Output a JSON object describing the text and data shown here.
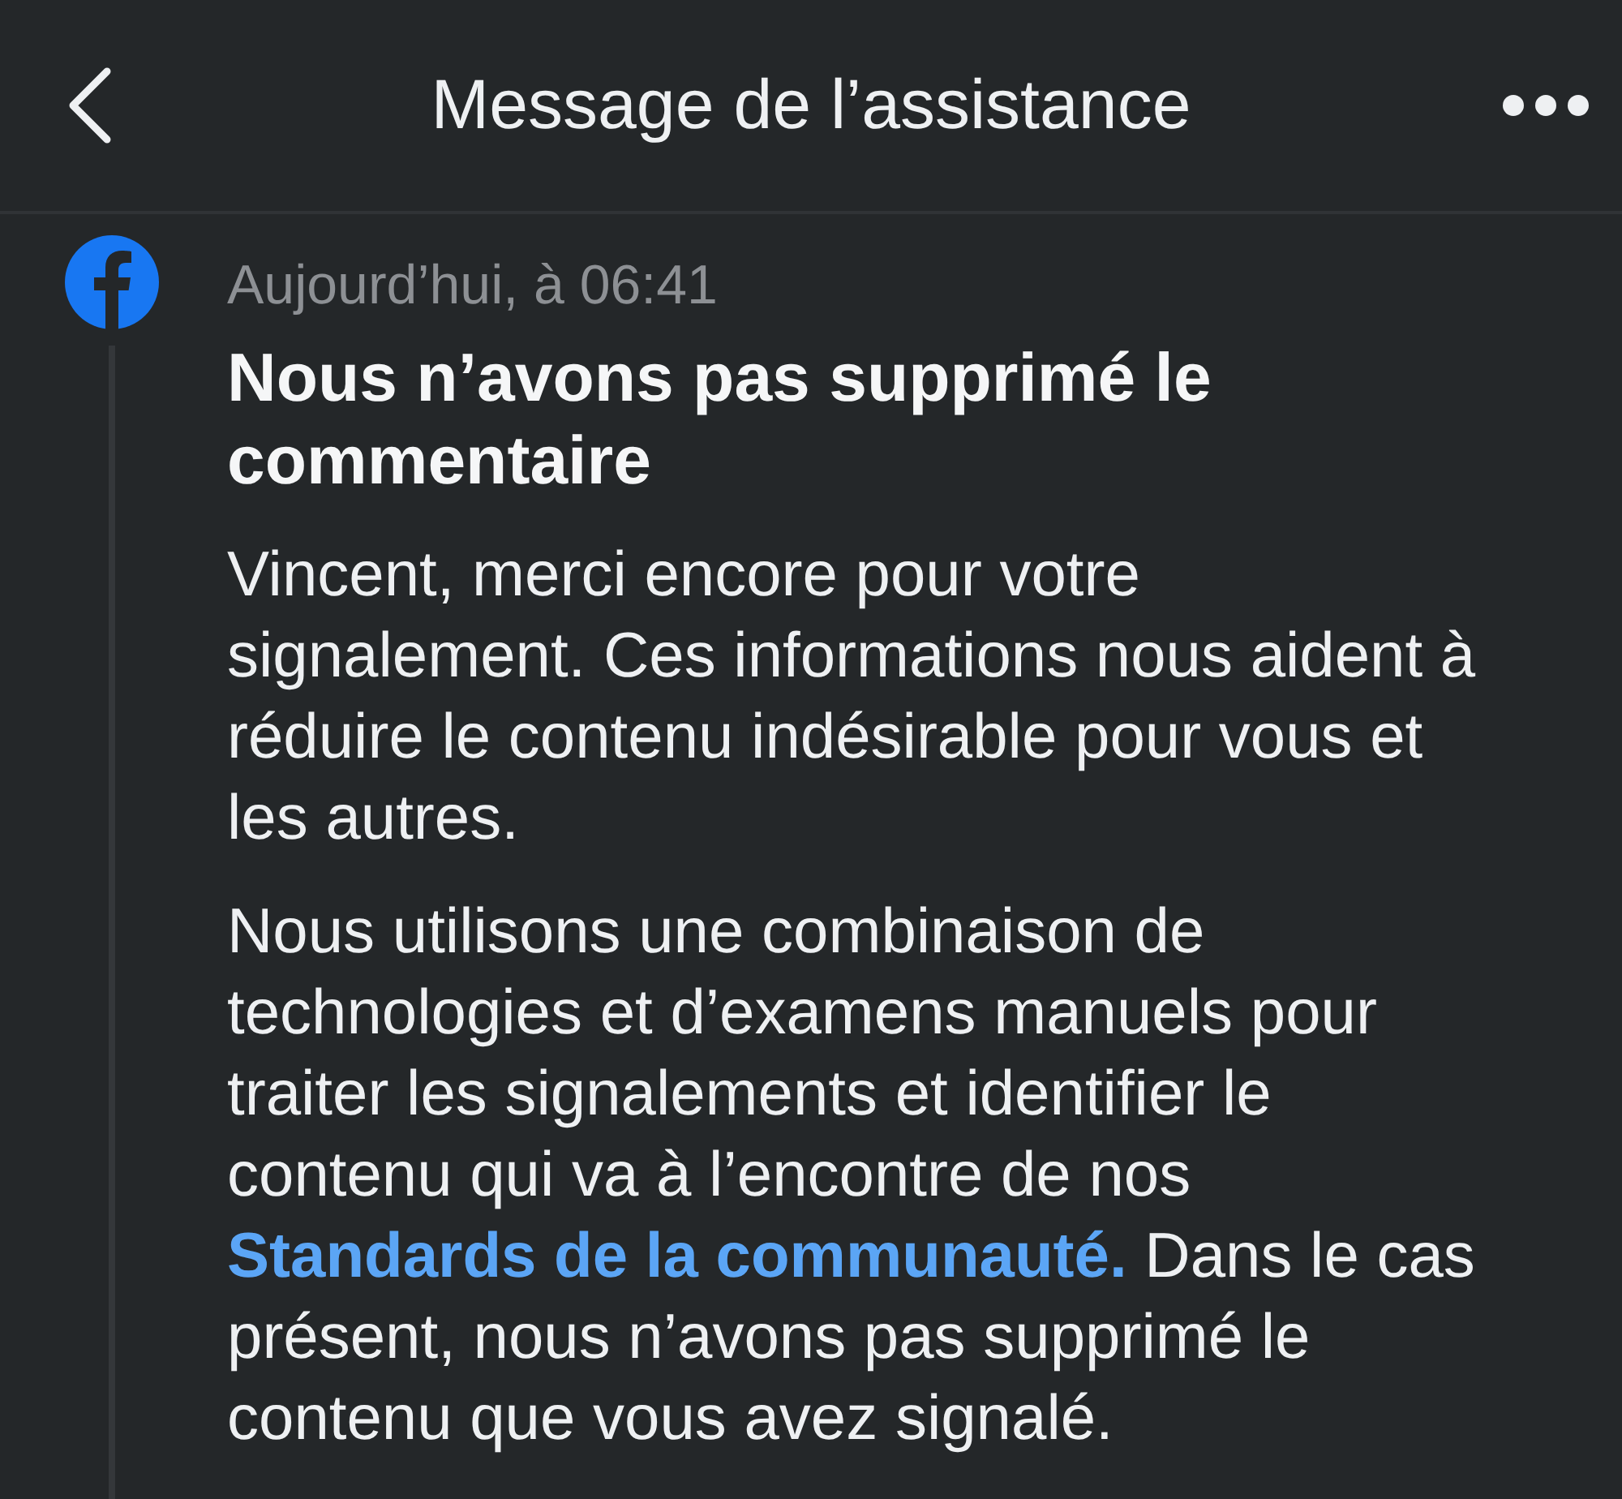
{
  "header": {
    "title": "Message de l’assistance"
  },
  "message": {
    "timestamp": "Aujourd’hui, à 06:41",
    "title": "Nous n’avons pas supprimé le commentaire",
    "paragraphs": [
      [
        {
          "kind": "text",
          "text": "Vincent, merci encore pour votre signalement. Ces informations nous aident à réduire le contenu indésirable pour vous et les autres."
        }
      ],
      [
        {
          "kind": "text",
          "text": "Nous utilisons une combinaison de technologies et d’examens manuels pour traiter les signalements et identifier le contenu qui va à l’encontre de nos"
        },
        {
          "kind": "link",
          "text": "Standards de la communauté."
        },
        {
          "kind": "text",
          "text": "Dans le cas présent, nous n’avons pas supprimé le contenu que vous avez signalé."
        }
      ]
    ]
  }
}
